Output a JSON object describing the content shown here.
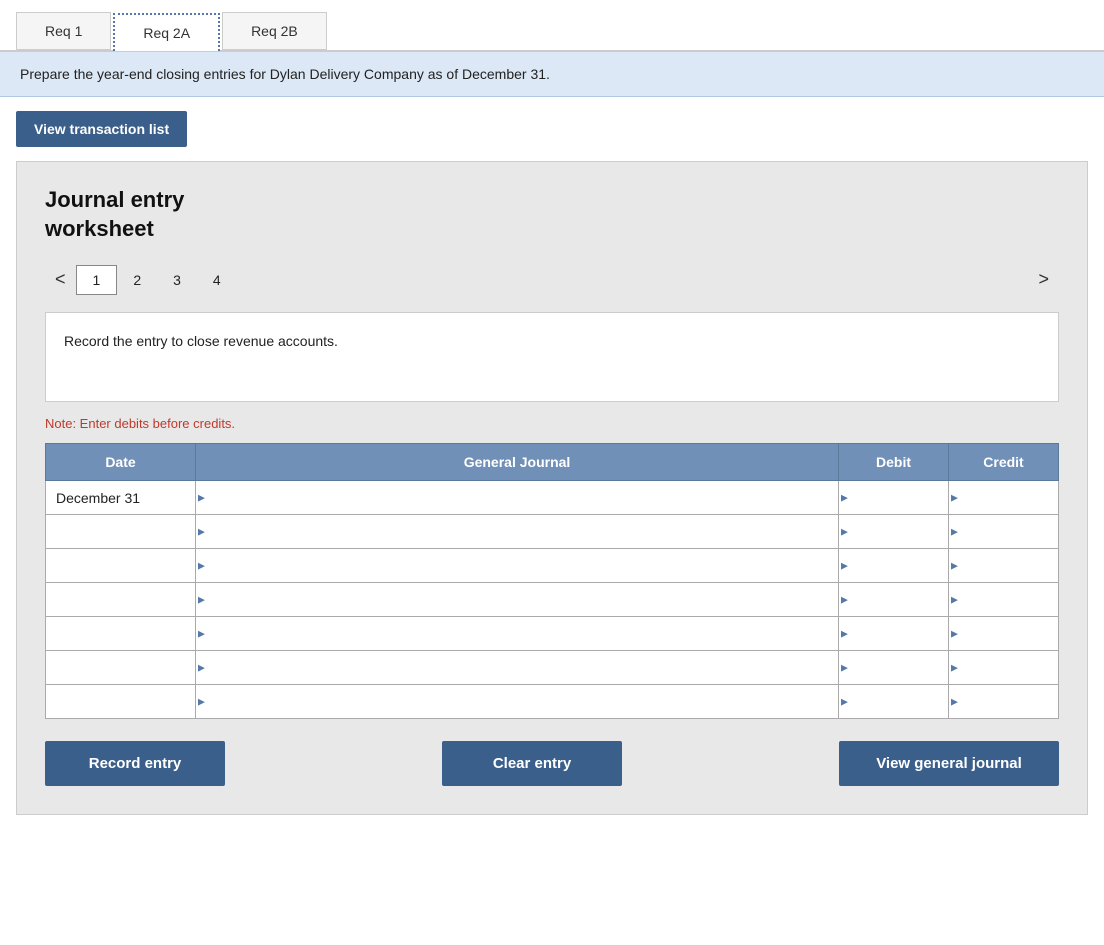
{
  "tabs": [
    {
      "id": "req1",
      "label": "Req 1",
      "active": false,
      "style": "plain"
    },
    {
      "id": "req2a",
      "label": "Req 2A",
      "active": true,
      "style": "dotted"
    },
    {
      "id": "req2b",
      "label": "Req 2B",
      "active": false,
      "style": "plain"
    }
  ],
  "instruction_bar": {
    "text": "Prepare the year-end closing entries for Dylan Delivery Company as of December 31."
  },
  "top_button": {
    "label": "View transaction list"
  },
  "worksheet": {
    "title_line1": "Journal entry",
    "title_line2": "worksheet",
    "pages": [
      {
        "num": "1",
        "active": true
      },
      {
        "num": "2",
        "active": false
      },
      {
        "num": "3",
        "active": false
      },
      {
        "num": "4",
        "active": false
      }
    ],
    "prev_arrow": "<",
    "next_arrow": ">",
    "instruction": "Record the entry to close revenue accounts.",
    "note": "Note: Enter debits before credits.",
    "table": {
      "headers": [
        "Date",
        "General Journal",
        "Debit",
        "Credit"
      ],
      "rows": [
        {
          "date": "December 31",
          "gj": "",
          "debit": "",
          "credit": ""
        },
        {
          "date": "",
          "gj": "",
          "debit": "",
          "credit": ""
        },
        {
          "date": "",
          "gj": "",
          "debit": "",
          "credit": ""
        },
        {
          "date": "",
          "gj": "",
          "debit": "",
          "credit": ""
        },
        {
          "date": "",
          "gj": "",
          "debit": "",
          "credit": ""
        },
        {
          "date": "",
          "gj": "",
          "debit": "",
          "credit": ""
        },
        {
          "date": "",
          "gj": "",
          "debit": "",
          "credit": ""
        }
      ]
    }
  },
  "buttons": {
    "record_entry": "Record entry",
    "clear_entry": "Clear entry",
    "view_general_journal": "View general journal"
  }
}
